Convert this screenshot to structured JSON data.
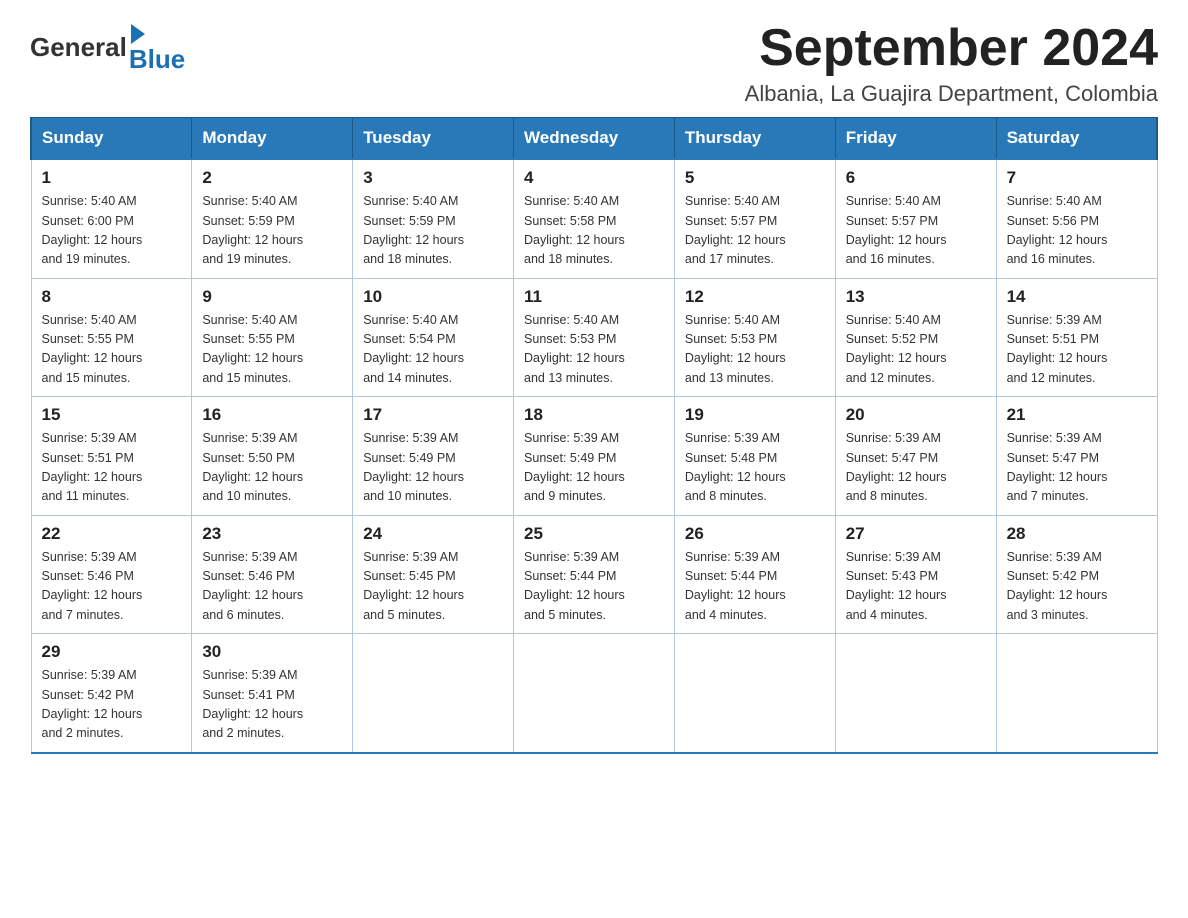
{
  "logo": {
    "general": "General",
    "blue": "Blue"
  },
  "title": "September 2024",
  "subtitle": "Albania, La Guajira Department, Colombia",
  "days_of_week": [
    "Sunday",
    "Monday",
    "Tuesday",
    "Wednesday",
    "Thursday",
    "Friday",
    "Saturday"
  ],
  "weeks": [
    [
      {
        "day": "1",
        "sunrise": "5:40 AM",
        "sunset": "6:00 PM",
        "daylight": "12 hours and 19 minutes."
      },
      {
        "day": "2",
        "sunrise": "5:40 AM",
        "sunset": "5:59 PM",
        "daylight": "12 hours and 19 minutes."
      },
      {
        "day": "3",
        "sunrise": "5:40 AM",
        "sunset": "5:59 PM",
        "daylight": "12 hours and 18 minutes."
      },
      {
        "day": "4",
        "sunrise": "5:40 AM",
        "sunset": "5:58 PM",
        "daylight": "12 hours and 18 minutes."
      },
      {
        "day": "5",
        "sunrise": "5:40 AM",
        "sunset": "5:57 PM",
        "daylight": "12 hours and 17 minutes."
      },
      {
        "day": "6",
        "sunrise": "5:40 AM",
        "sunset": "5:57 PM",
        "daylight": "12 hours and 16 minutes."
      },
      {
        "day": "7",
        "sunrise": "5:40 AM",
        "sunset": "5:56 PM",
        "daylight": "12 hours and 16 minutes."
      }
    ],
    [
      {
        "day": "8",
        "sunrise": "5:40 AM",
        "sunset": "5:55 PM",
        "daylight": "12 hours and 15 minutes."
      },
      {
        "day": "9",
        "sunrise": "5:40 AM",
        "sunset": "5:55 PM",
        "daylight": "12 hours and 15 minutes."
      },
      {
        "day": "10",
        "sunrise": "5:40 AM",
        "sunset": "5:54 PM",
        "daylight": "12 hours and 14 minutes."
      },
      {
        "day": "11",
        "sunrise": "5:40 AM",
        "sunset": "5:53 PM",
        "daylight": "12 hours and 13 minutes."
      },
      {
        "day": "12",
        "sunrise": "5:40 AM",
        "sunset": "5:53 PM",
        "daylight": "12 hours and 13 minutes."
      },
      {
        "day": "13",
        "sunrise": "5:40 AM",
        "sunset": "5:52 PM",
        "daylight": "12 hours and 12 minutes."
      },
      {
        "day": "14",
        "sunrise": "5:39 AM",
        "sunset": "5:51 PM",
        "daylight": "12 hours and 12 minutes."
      }
    ],
    [
      {
        "day": "15",
        "sunrise": "5:39 AM",
        "sunset": "5:51 PM",
        "daylight": "12 hours and 11 minutes."
      },
      {
        "day": "16",
        "sunrise": "5:39 AM",
        "sunset": "5:50 PM",
        "daylight": "12 hours and 10 minutes."
      },
      {
        "day": "17",
        "sunrise": "5:39 AM",
        "sunset": "5:49 PM",
        "daylight": "12 hours and 10 minutes."
      },
      {
        "day": "18",
        "sunrise": "5:39 AM",
        "sunset": "5:49 PM",
        "daylight": "12 hours and 9 minutes."
      },
      {
        "day": "19",
        "sunrise": "5:39 AM",
        "sunset": "5:48 PM",
        "daylight": "12 hours and 8 minutes."
      },
      {
        "day": "20",
        "sunrise": "5:39 AM",
        "sunset": "5:47 PM",
        "daylight": "12 hours and 8 minutes."
      },
      {
        "day": "21",
        "sunrise": "5:39 AM",
        "sunset": "5:47 PM",
        "daylight": "12 hours and 7 minutes."
      }
    ],
    [
      {
        "day": "22",
        "sunrise": "5:39 AM",
        "sunset": "5:46 PM",
        "daylight": "12 hours and 7 minutes."
      },
      {
        "day": "23",
        "sunrise": "5:39 AM",
        "sunset": "5:46 PM",
        "daylight": "12 hours and 6 minutes."
      },
      {
        "day": "24",
        "sunrise": "5:39 AM",
        "sunset": "5:45 PM",
        "daylight": "12 hours and 5 minutes."
      },
      {
        "day": "25",
        "sunrise": "5:39 AM",
        "sunset": "5:44 PM",
        "daylight": "12 hours and 5 minutes."
      },
      {
        "day": "26",
        "sunrise": "5:39 AM",
        "sunset": "5:44 PM",
        "daylight": "12 hours and 4 minutes."
      },
      {
        "day": "27",
        "sunrise": "5:39 AM",
        "sunset": "5:43 PM",
        "daylight": "12 hours and 4 minutes."
      },
      {
        "day": "28",
        "sunrise": "5:39 AM",
        "sunset": "5:42 PM",
        "daylight": "12 hours and 3 minutes."
      }
    ],
    [
      {
        "day": "29",
        "sunrise": "5:39 AM",
        "sunset": "5:42 PM",
        "daylight": "12 hours and 2 minutes."
      },
      {
        "day": "30",
        "sunrise": "5:39 AM",
        "sunset": "5:41 PM",
        "daylight": "12 hours and 2 minutes."
      },
      null,
      null,
      null,
      null,
      null
    ]
  ]
}
